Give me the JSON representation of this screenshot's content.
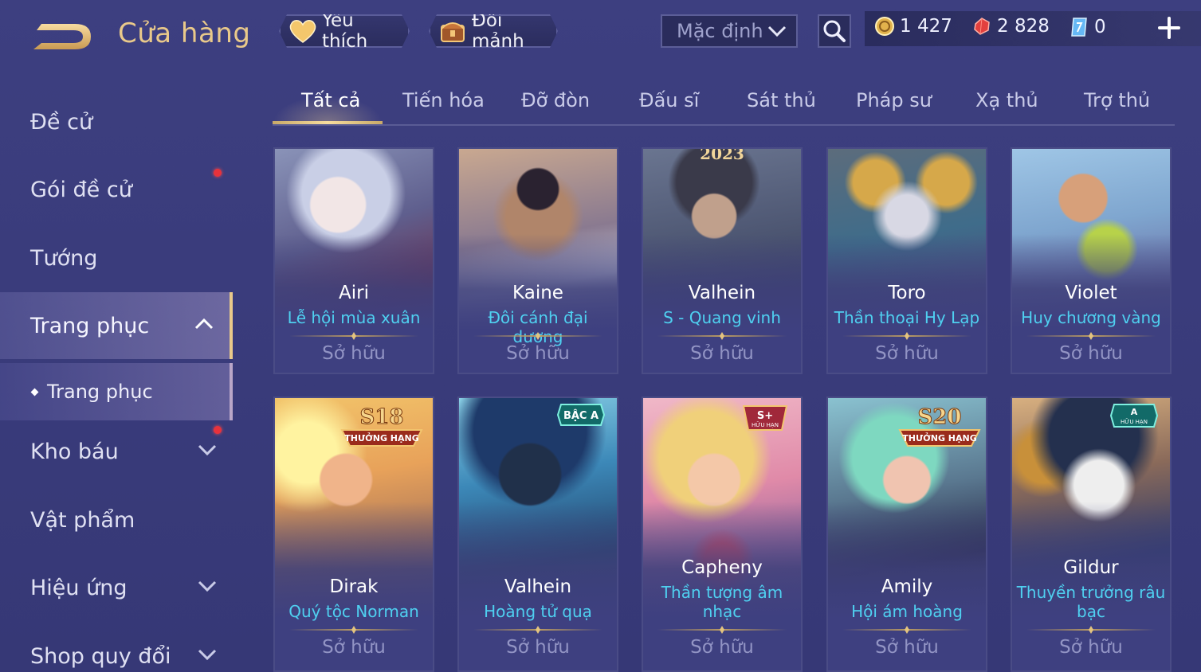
{
  "header": {
    "title": "Cửa hàng",
    "favorites_label": "Yêu thích",
    "exchange_label": "Đổi mảnh",
    "sort_value": "Mặc định"
  },
  "currencies": [
    {
      "icon": "gold-coin-icon",
      "value": "1 427"
    },
    {
      "icon": "ruby-icon",
      "value": "2 828"
    },
    {
      "icon": "voucher-icon",
      "value": "0"
    }
  ],
  "sidebar": {
    "items": [
      {
        "label": "Đề cử"
      },
      {
        "label": "Gói đề cử"
      },
      {
        "label": "Tướng"
      },
      {
        "label": "Trang phục"
      },
      {
        "label": "Kho báu"
      },
      {
        "label": "Vật phẩm"
      },
      {
        "label": "Hiệu ứng"
      },
      {
        "label": "Shop quy đổi"
      }
    ],
    "sub_item": "Trang phục"
  },
  "tabs": [
    "Tất cả",
    "Tiến hóa",
    "Đỡ đòn",
    "Đấu sĩ",
    "Sát thủ",
    "Pháp sư",
    "Xạ thủ",
    "Trợ thủ"
  ],
  "owned_label": "Sở hữu",
  "cards": [
    {
      "hero": "Airi",
      "skin": "Lễ hội mùa xuân",
      "badge": ""
    },
    {
      "hero": "Kaine",
      "skin": "Đôi cánh đại dương",
      "badge": ""
    },
    {
      "hero": "Valhein",
      "skin": "S - Quang vinh",
      "badge": "2023"
    },
    {
      "hero": "Toro",
      "skin": "Thần thoại Hy Lạp",
      "badge": ""
    },
    {
      "hero": "Violet",
      "skin": "Huy chương vàng",
      "badge": ""
    },
    {
      "hero": "Dirak",
      "skin": "Quý tộc Norman",
      "badge": "S18",
      "badge_sub": "THƯỞNG HẠNG"
    },
    {
      "hero": "Valhein",
      "skin": "Hoàng tử quạ",
      "badge": "BẬC A"
    },
    {
      "hero": "Capheny",
      "skin": "Thần tượng âm nhạc",
      "badge": "S+",
      "badge_sub": "HỮU HẠN"
    },
    {
      "hero": "Amily",
      "skin": "Hội ám hoàng",
      "badge": "S20",
      "badge_sub": "THƯỞNG HẠNG"
    },
    {
      "hero": "Gildur",
      "skin": "Thuyền trưởng râu bạc",
      "badge": "A",
      "badge_sub": "HỮU HẠN"
    }
  ]
}
